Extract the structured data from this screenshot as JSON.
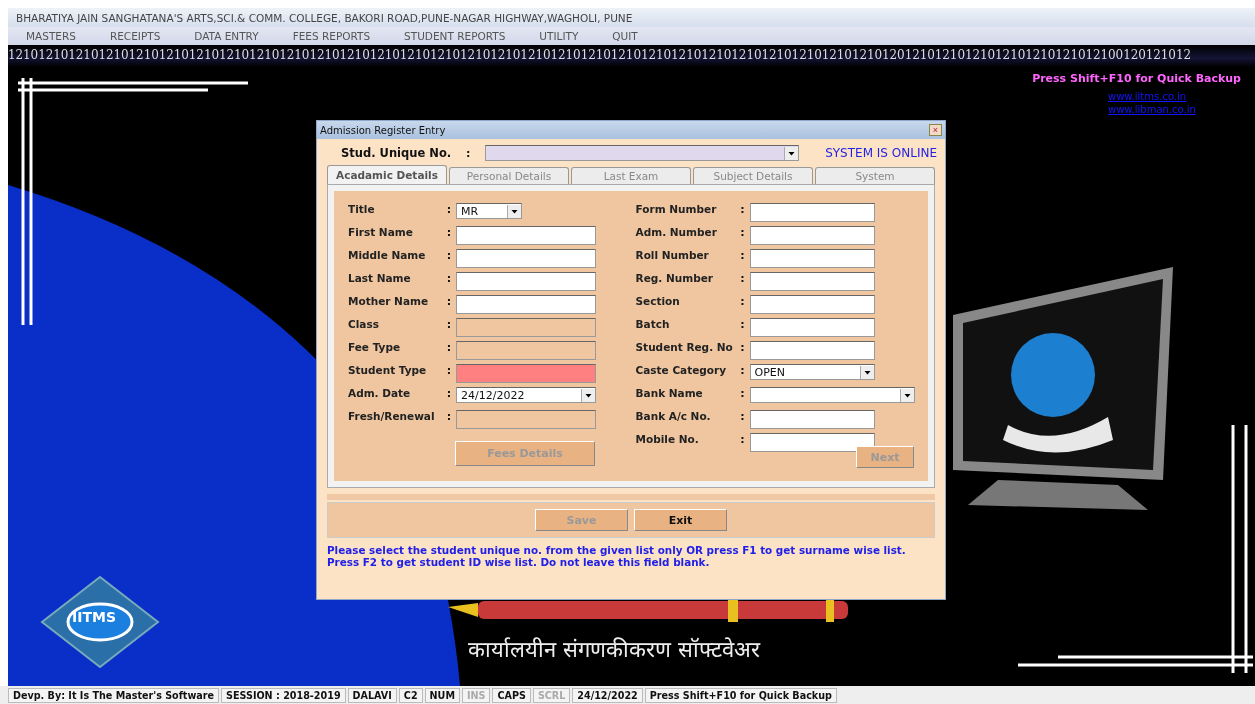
{
  "window": {
    "title": "BHARATIYA JAIN SANGHATANA'S ARTS,SCI.& COMM. COLLEGE, BAKORI ROAD,PUNE-NAGAR HIGHWAY,WAGHOLI, PUNE"
  },
  "menu": [
    "MASTERS",
    "RECEIPTS",
    "DATA ENTRY",
    "FEES REPORTS",
    "STUDENT REPORTS",
    "UTILITY",
    "QUIT"
  ],
  "desktop": {
    "binary_strip": "1210121012101210121012101210121012101210121012101210121012101210121012101210121012101210121012101210121012101210121012012101210121012101210121012100120121012",
    "backup_hint": "Press Shift+F10 for Quick Backup",
    "links": [
      "www.iitms.co.in",
      "www.libman.co.in"
    ],
    "logo_text": "IITMS",
    "tagline": "कार्यालयीन संगणकीकरण सॉफ्टवेअर"
  },
  "dialog": {
    "title": "Admission Register Entry",
    "close": "×",
    "unique_no": {
      "label": "Stud. Unique No.",
      "colon": ":"
    },
    "online_status": "SYSTEM IS ONLINE",
    "tabs": [
      {
        "label": "Acadamic Details",
        "selected": true
      },
      {
        "label": "Personal Details",
        "selected": false
      },
      {
        "label": "Last Exam",
        "selected": false
      },
      {
        "label": "Subject Details",
        "selected": false
      },
      {
        "label": "System",
        "selected": false
      }
    ],
    "left_fields": [
      {
        "label": "Title",
        "kind": "combo",
        "value": "MR"
      },
      {
        "label": "First Name",
        "kind": "text"
      },
      {
        "label": "Middle Name",
        "kind": "text"
      },
      {
        "label": "Last Name",
        "kind": "text"
      },
      {
        "label": "Mother Name",
        "kind": "text"
      },
      {
        "label": "Class",
        "kind": "locked"
      },
      {
        "label": "Fee Type",
        "kind": "locked"
      },
      {
        "label": "Student Type",
        "kind": "required"
      },
      {
        "label": "Adm. Date",
        "kind": "combo",
        "value": "24/12/2022"
      },
      {
        "label": "Fresh/Renewal",
        "kind": "locked"
      }
    ],
    "right_fields": [
      {
        "label": "Form Number",
        "kind": "text"
      },
      {
        "label": "Adm. Number",
        "kind": "text"
      },
      {
        "label": "Roll Number",
        "kind": "text"
      },
      {
        "label": "Reg. Number",
        "kind": "text"
      },
      {
        "label": "Section",
        "kind": "text"
      },
      {
        "label": "Batch",
        "kind": "text"
      },
      {
        "label": "Student Reg. No",
        "kind": "text"
      },
      {
        "label": "Caste Category",
        "kind": "combo",
        "value": "OPEN"
      },
      {
        "label": "Bank Name",
        "kind": "wide_combo"
      },
      {
        "label": "Bank A/c No.",
        "kind": "text"
      },
      {
        "label": "Mobile No.",
        "kind": "text"
      }
    ],
    "colon": ":",
    "fees_button": {
      "label": "Fees Details",
      "disabled": true
    },
    "next_button": {
      "label": "Next",
      "disabled": true
    },
    "buttons": [
      {
        "label": "Save",
        "disabled": true
      },
      {
        "label": "Exit",
        "disabled": false
      }
    ],
    "help": "Please select the student unique no. from the given list only OR press F1 to get surname wise list. Press F2 to get student ID wise list. Do not leave this field blank."
  },
  "status_bar": [
    {
      "text": "Devp. By: It Is The Master's Software",
      "active": true
    },
    {
      "text": "SESSION : 2018-2019",
      "active": true
    },
    {
      "text": "DALAVI",
      "active": true
    },
    {
      "text": "C2",
      "active": true
    },
    {
      "text": "NUM",
      "active": true
    },
    {
      "text": "INS",
      "active": false
    },
    {
      "text": "CAPS",
      "active": true
    },
    {
      "text": "SCRL",
      "active": false
    },
    {
      "text": "24/12/2022",
      "active": true
    },
    {
      "text": "Press Shift+F10 for Quick Backup",
      "active": true
    }
  ]
}
